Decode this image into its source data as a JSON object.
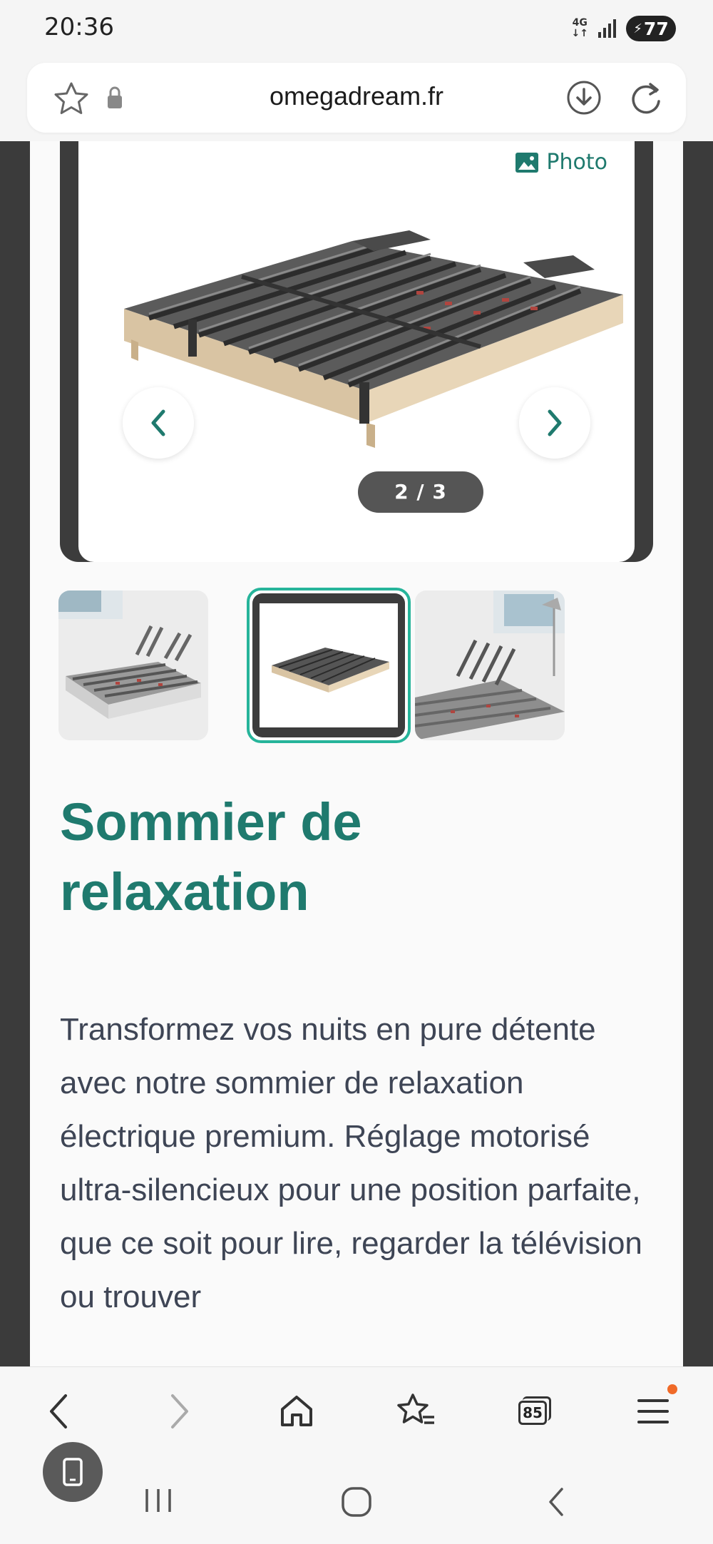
{
  "status_bar": {
    "time": "20:36",
    "network": "4G",
    "battery": "77"
  },
  "browser": {
    "url": "omegadream.fr",
    "icons": [
      "star-icon",
      "lock-icon",
      "download-icon",
      "reload-icon"
    ]
  },
  "gallery": {
    "photo_label": "Photo",
    "counter": "2 / 3",
    "current_index": 2,
    "total": 3
  },
  "product": {
    "title": "Sommier de relaxation",
    "description": "Transformez vos nuits en pure détente avec notre sommier de relaxation électrique premium. Réglage motorisé ultra-silencieux pour une position parfaite, que ce soit pour lire, regarder la télévision ou trouver"
  },
  "toolbar": {
    "tabs_count": "85",
    "icons": [
      "back-icon",
      "forward-icon",
      "home-icon",
      "bookmarks-icon",
      "tabs-icon",
      "menu-icon"
    ]
  },
  "colors": {
    "brand": "#1f7a6e",
    "accent": "#26b49a",
    "text": "#3e4555",
    "notification": "#f06a28"
  }
}
